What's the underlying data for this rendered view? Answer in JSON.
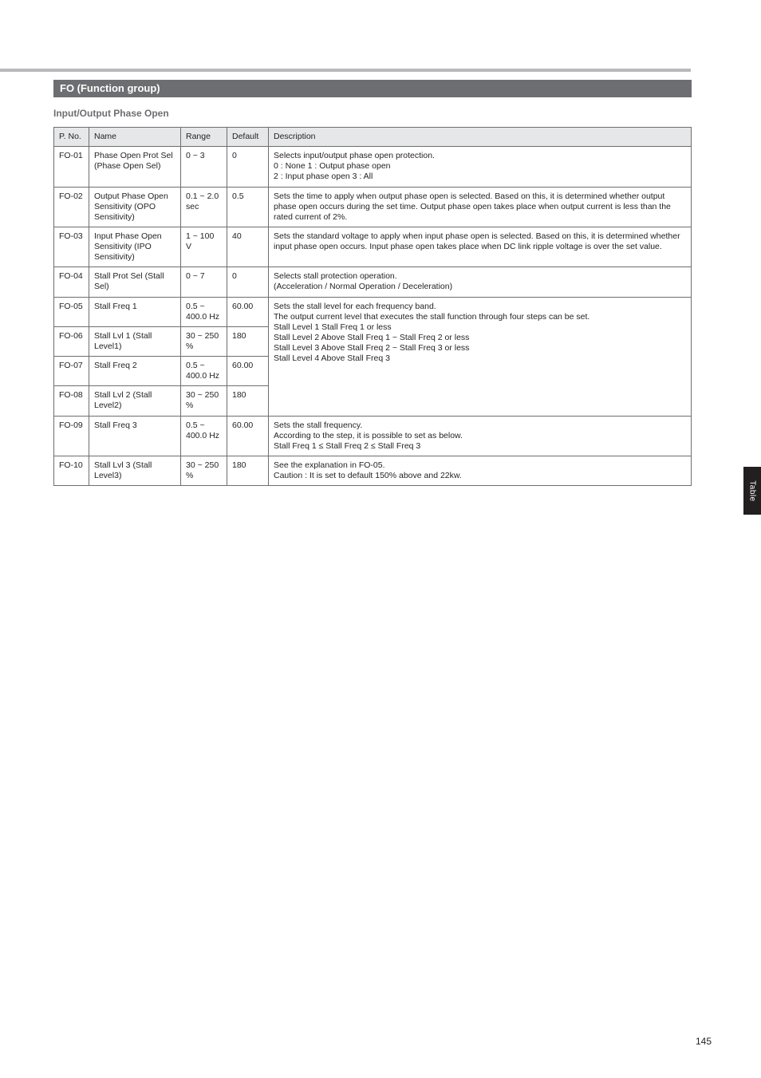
{
  "sectionTitle": "FO (Function group)",
  "subtitle": "Input/Output Phase Open",
  "sideTab": "Table",
  "pageNumber": "145",
  "headers": {
    "pno": "P. No.",
    "name": "Name",
    "range": "Range",
    "def": "Default",
    "desc": "Description"
  },
  "rows": [
    {
      "pno": "FO-01",
      "name": "Phase Open Prot Sel (Phase Open Sel)",
      "range": "0 ~ 3",
      "def": "0",
      "desc": "Selects input/output phase open protection.\n0 : None                    1 : Output phase open\n2 : Input phase open   3 : All"
    },
    {
      "pno": "FO-02",
      "name": "Output Phase Open Sensitivity (OPO Sensitivity)",
      "range": "0.1 ~ 2.0 sec",
      "def": "0.5",
      "desc": "Sets the time to apply when output phase open is selected. Based on this, it is determined whether output phase open occurs during the set time. Output phase open takes place when output current is less than the rated current of 2%."
    },
    {
      "pno": "FO-03",
      "name": "Input Phase Open Sensitivity (IPO Sensitivity)",
      "range": "1 ~ 100 V",
      "def": "40",
      "desc": "Sets the standard voltage to apply when input phase open is selected. Based on this, it is determined whether input phase open occurs. Input phase open takes place when DC link ripple voltage is over the set value."
    },
    {
      "pno": "FO-04",
      "name": "Stall Prot Sel (Stall Sel)",
      "range": "0 ~ 7",
      "def": "0",
      "desc": "Selects stall protection operation.\n(Acceleration / Normal Operation / Deceleration)"
    },
    {
      "pno": "FO-05",
      "name": "Stall Freq 1",
      "range": "0.5 ~ 400.0 Hz",
      "def": "60.00",
      "descRef": 4
    },
    {
      "pno": "FO-06",
      "name": "Stall Lvl 1 (Stall Level1)",
      "range": "30 ~ 250 %",
      "def": "180",
      "descRef": 4
    },
    {
      "pno": "FO-07",
      "name": "Stall Freq 2",
      "range": "0.5 ~ 400.0 Hz",
      "def": "60.00",
      "descRef": 4
    },
    {
      "pno": "FO-08",
      "name": "Stall Lvl 2 (Stall Level2)",
      "range": "30 ~ 250 %",
      "def": "180",
      "descRef": 4,
      "descMerged": "Sets the stall level for each frequency band.\nThe output current level that executes the stall function through four steps can be set.\n                          Stall Level 1   Stall Freq 1 or less\n                          Stall Level 2   Above Stall Freq 1 ~ Stall Freq 2 or less\n                          Stall Level 3   Above Stall Freq 2 ~ Stall Freq 3 or less\n                          Stall Level 4   Above Stall Freq 3"
    },
    {
      "pno": "FO-09",
      "name": "Stall Freq 3",
      "range": "0.5 ~ 400.0 Hz",
      "def": "60.00",
      "desc": "Sets the stall frequency.\nAccording to the step, it is possible to set as below.\n                      Stall Freq 1 ≤ Stall Freq 2 ≤ Stall Freq 3"
    },
    {
      "pno": "FO-10",
      "name": "Stall Lvl 3 (Stall Level3)",
      "range": "30 ~ 250 %",
      "def": "180",
      "desc": "See the explanation in FO-05.\nCaution : It is set to default 150% above and 22kw."
    }
  ]
}
